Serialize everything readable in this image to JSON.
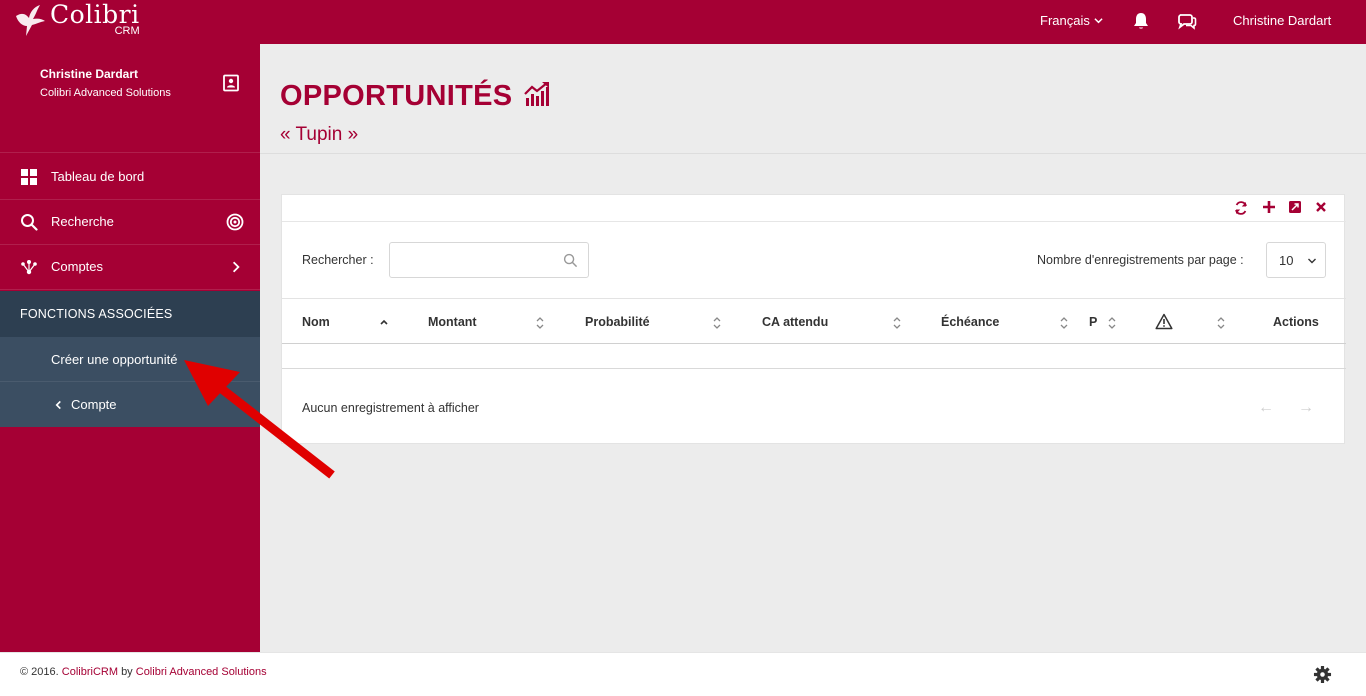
{
  "brand": {
    "name": "Colibri",
    "sub": "CRM"
  },
  "topbar": {
    "language": "Français",
    "user_name": "Christine Dardart"
  },
  "sidebar": {
    "user_name": "Christine Dardart",
    "company": "Colibri Advanced Solutions",
    "items": [
      {
        "label": "Tableau de bord",
        "icon": "dashboard-icon"
      },
      {
        "label": "Recherche",
        "icon": "search-icon"
      },
      {
        "label": "Comptes",
        "icon": "accounts-icon"
      }
    ],
    "assoc_header": "FONCTIONS ASSOCIÉES",
    "assoc_items": [
      {
        "label": "Créer une opportunité"
      },
      {
        "label": "Compte"
      }
    ]
  },
  "page": {
    "title": "OPPORTUNITÉS",
    "subtitle": "« Tupin »"
  },
  "table": {
    "search_label": "Rechercher :",
    "search_value": "",
    "per_page_label": "Nombre d'enregistrements par page :",
    "per_page_value": "10",
    "columns": [
      {
        "label": "Nom"
      },
      {
        "label": "Montant"
      },
      {
        "label": "Probabilité"
      },
      {
        "label": "CA attendu"
      },
      {
        "label": "Échéance"
      },
      {
        "label": "P"
      },
      {
        "label": ""
      },
      {
        "label": "Actions"
      }
    ],
    "empty_message": "Aucun enregistrement à afficher",
    "prev_label": "←",
    "next_label": "→"
  },
  "footer": {
    "copyright": "© 2016.",
    "product": "ColibriCRM",
    "by": "by",
    "company": "Colibri Advanced Solutions"
  },
  "colors": {
    "brand": "#a50034",
    "assoc_dark": "#2d3f51",
    "assoc_item": "#3b4e62",
    "arrow": "#e00000"
  }
}
